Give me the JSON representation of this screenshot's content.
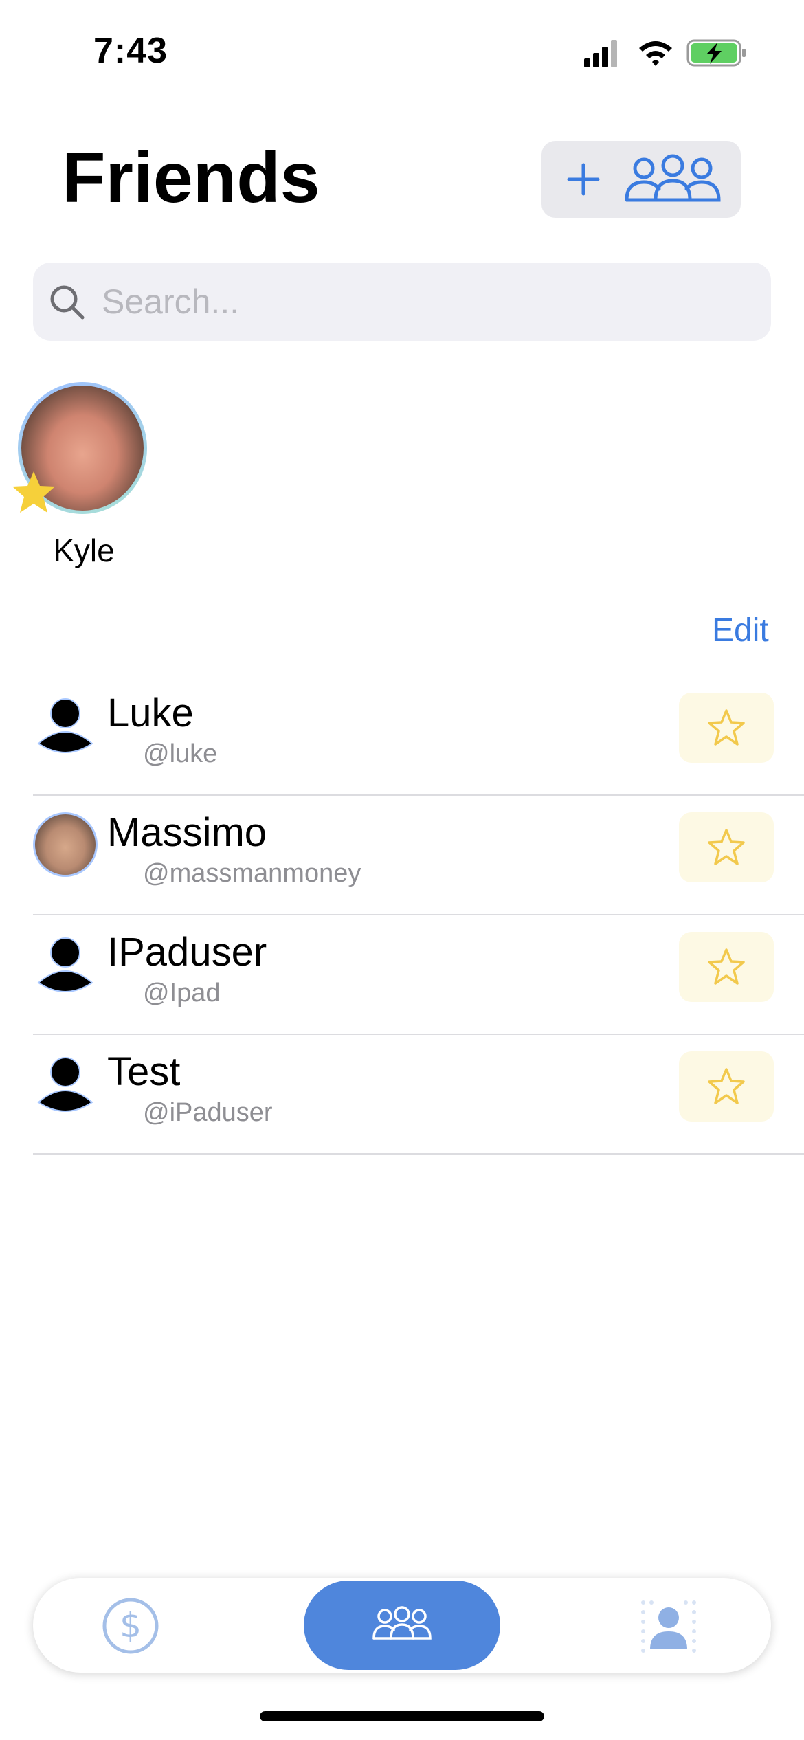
{
  "status_bar": {
    "time": "7:43"
  },
  "header": {
    "title": "Friends"
  },
  "search": {
    "placeholder": "Search..."
  },
  "favorites": [
    {
      "name": "Kyle"
    }
  ],
  "list": {
    "edit_label": "Edit",
    "friends": [
      {
        "name": "Luke",
        "handle": "@luke",
        "avatar": "default-avatar-icon"
      },
      {
        "name": "Massimo",
        "handle": "@massmanmoney",
        "avatar": "photo"
      },
      {
        "name": "IPaduser",
        "handle": "@Ipad",
        "avatar": "default-avatar-icon"
      },
      {
        "name": "Test",
        "handle": "@iPaduser",
        "avatar": "default-avatar-icon"
      }
    ]
  },
  "tab_bar": {
    "tabs": [
      {
        "name": "wallet",
        "icon": "dollar-circle-icon"
      },
      {
        "name": "friends",
        "icon": "people-icon",
        "active": true
      },
      {
        "name": "profile",
        "icon": "person-icon"
      }
    ]
  },
  "colors": {
    "accent": "#3a7be0",
    "tab_active": "#4f86dc",
    "star": "#f6d03a",
    "star_button_bg": "#fdf9e4",
    "search_bg": "#f0f0f5"
  }
}
